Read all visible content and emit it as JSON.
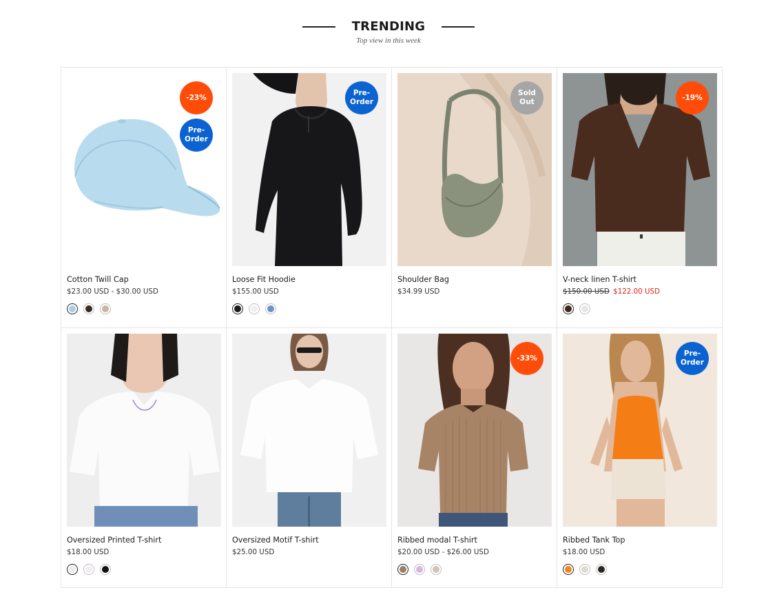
{
  "section": {
    "title": "TRENDING",
    "subtitle": "Top view in this week"
  },
  "colors": {
    "sale_badge": "#ff4d09",
    "preorder_badge": "#0b63d1",
    "soldout_badge": "#a6a6a6",
    "sale_price": "#e0231a"
  },
  "products": [
    {
      "name": "Cotton Twill Cap",
      "price": "$23.00 USD - $30.00 USD",
      "badges": [
        {
          "label": "-23%",
          "type": "sale"
        },
        {
          "label": "Pre-\nOrder",
          "type": "preorder"
        }
      ],
      "image": "light-blue-cap",
      "swatches": [
        "#a9cfe8",
        "#3b2a22",
        "#c8b79a"
      ]
    },
    {
      "name": "Loose Fit Hoodie",
      "price": "$155.00 USD",
      "badges": [
        {
          "label": "Pre-\nOrder",
          "type": "preorder"
        }
      ],
      "image": "black-hoodie",
      "swatches": [
        "#1c1c1c",
        "#f0efec",
        "#6f93c9"
      ]
    },
    {
      "name": "Shoulder Bag",
      "price": "$34.99 USD",
      "badges": [
        {
          "label": "Sold\nOut",
          "type": "soldout"
        }
      ],
      "image": "olive-shoulder-bag",
      "swatches": []
    },
    {
      "name": "V-neck linen T-shirt",
      "price_old": "$150.00 USD",
      "price_sale": "$122.00 USD",
      "badges": [
        {
          "label": "-19%",
          "type": "sale"
        }
      ],
      "image": "brown-vneck-tshirt",
      "swatches": [
        "#3e2518",
        "#e8e6e2"
      ]
    },
    {
      "name": "Oversized Printed T-shirt",
      "price": "$18.00 USD",
      "badges": [],
      "image": "white-printed-tshirt",
      "swatches": [
        "#ececec",
        "#f4ecf5",
        "#111111"
      ]
    },
    {
      "name": "Oversized Motif T-shirt",
      "price": "$25.00 USD",
      "badges": [],
      "image": "white-motif-tshirt",
      "swatches": []
    },
    {
      "name": "Ribbed modal T-shirt",
      "price": "$20.00 USD - $26.00 USD",
      "badges": [
        {
          "label": "-33%",
          "type": "sale"
        }
      ],
      "image": "tan-ribbed-tshirt",
      "swatches": [
        "#9d7f63",
        "#d7b6d9",
        "#d2c3b4"
      ]
    },
    {
      "name": "Ribbed Tank Top",
      "price": "$18.00 USD",
      "badges": [
        {
          "label": "Pre-\nOrder",
          "type": "preorder"
        }
      ],
      "image": "orange-tank-top",
      "swatches": [
        "#f2841e",
        "#dedad3",
        "#2b2622"
      ]
    }
  ]
}
